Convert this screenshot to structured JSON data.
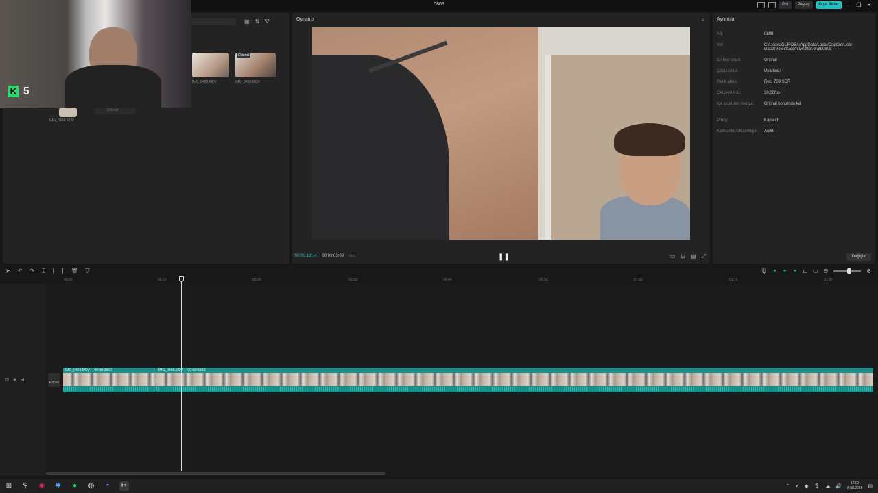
{
  "window": {
    "title": "0808"
  },
  "titlebar": {
    "pro_label": "Pro",
    "share_label": "Paylaş",
    "export_label": "Dışa Aktar"
  },
  "media": {
    "clips": [
      {
        "name": "IMG_0485.MOV"
      },
      {
        "name": "IMG_0486.MOV",
        "badge": "Eklendi"
      },
      {
        "name": "IMG_0484.MOV"
      },
      {
        "name": "Eklendi"
      }
    ]
  },
  "webcam": {
    "badge_letter": "K",
    "badge_number": "5"
  },
  "player": {
    "title": "Oynatıcı",
    "current_time": "00:00:12:14",
    "total_time": "00:03:03:09"
  },
  "details": {
    "title": "Ayrıntılar",
    "rows": [
      {
        "key": "Ad:",
        "value": "0808"
      },
      {
        "key": "Yol:",
        "value": "C:/Users/GUROSA/AppData/Local/CapCut/User Data/Projects/com.lveditor.draft/0808"
      },
      {
        "key": "En boy oranı:",
        "value": "Orijinal"
      },
      {
        "key": "Çözünürlük:",
        "value": "Uyarlaıdı"
      },
      {
        "key": "Renk alanı:",
        "value": "Rec. 709 SDR"
      },
      {
        "key": "Çerçeve hızı:",
        "value": "30.00fps"
      },
      {
        "key": "İçe aktarılan medya:",
        "value": "Orijinal konumda kal"
      },
      {
        "key": "Proxy:",
        "value": "Kapalıdı"
      },
      {
        "key": "Katmanları düzenleyin:",
        "value": "Açıldı"
      }
    ],
    "edit_label": "Değiştir"
  },
  "timeline": {
    "ticks": [
      "00:00",
      "00:10",
      "00:20",
      "00:30",
      "00:40",
      "00:50",
      "01:00",
      "01:10",
      "01:20"
    ],
    "cover_label": "Kapak",
    "clips": [
      {
        "name": "IMG_0484.MOV",
        "duration": "00:00:09:03"
      },
      {
        "name": "IMG_0485.MOV",
        "duration": "00:02:53:16"
      }
    ]
  },
  "taskbar": {
    "time": "12:02",
    "date": "8.08.2025"
  }
}
